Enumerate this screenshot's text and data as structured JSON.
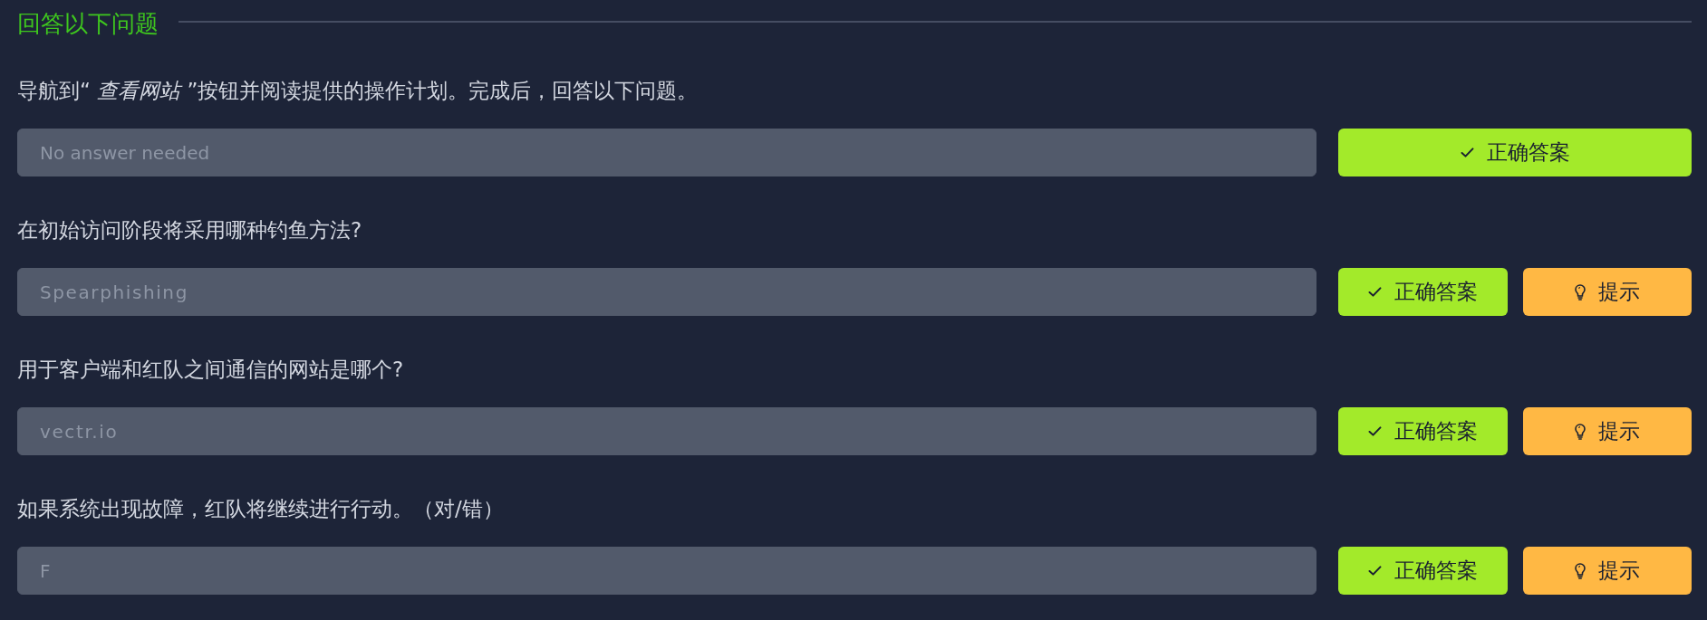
{
  "section": {
    "title": "回答以下问题"
  },
  "questions": [
    {
      "text": "导航到“ *查看网站* ”按钮并阅读提供的操作计划。完成后，回答以下问题。",
      "answer": {
        "placeholder": "No answer needed"
      },
      "buttons": [
        {
          "kind": "correct",
          "label": "正确答案"
        }
      ]
    },
    {
      "text": "在初始访问阶段将采用哪种钓鱼方法?",
      "answer": {
        "value": "Spearphishing"
      },
      "buttons": [
        {
          "kind": "correct",
          "label": "正确答案"
        },
        {
          "kind": "hint",
          "label": "提示"
        }
      ]
    },
    {
      "text": "用于客户端和红队之间通信的网站是哪个?",
      "answer": {
        "value": "vectr.io"
      },
      "buttons": [
        {
          "kind": "correct",
          "label": "正确答案"
        },
        {
          "kind": "hint",
          "label": "提示"
        }
      ]
    },
    {
      "text": "如果系统出现故障，红队将继续进行行动。（对/错）",
      "answer": {
        "value": "F"
      },
      "buttons": [
        {
          "kind": "correct",
          "label": "正确答案"
        },
        {
          "kind": "hint",
          "label": "提示"
        }
      ]
    }
  ]
}
